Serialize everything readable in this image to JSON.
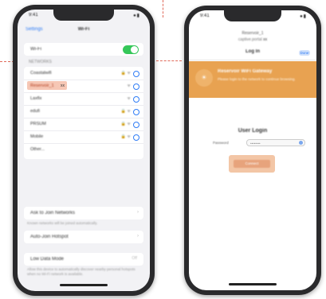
{
  "left_phone": {
    "status_time": "9:41",
    "status_icons": "●▮",
    "nav_back": "Settings",
    "nav_title": "Wi-Fi",
    "wifi_label": "Wi-Fi",
    "section_header": "NETWORKS",
    "networks": [
      {
        "name": "Coastalwifi",
        "meta": "🔒 ᯤ"
      },
      {
        "name": "Reservoir_1",
        "meta": "ᯤ"
      },
      {
        "name": "Laxfix",
        "meta": "ᯤ"
      },
      {
        "name": "edufi",
        "meta": "🔒 ᯤ"
      },
      {
        "name": "PRSUM",
        "meta": "🔒 ᯤ"
      },
      {
        "name": "Mobile",
        "meta": "🔒 ᯤ"
      },
      {
        "name": "Other...",
        "meta": ""
      }
    ],
    "highlight_mark": "xx",
    "ask_join_label": "Ask to Join Networks",
    "ask_join_footer": "Known networks will be joined automatically.",
    "hotspot_label": "Auto-Join Hotspot",
    "low_data_label": "Low Data Mode",
    "low_data_value": "Off",
    "footer_text": "Allow this device to automatically discover nearby personal hotspots when no Wi-Fi network is available."
  },
  "right_phone": {
    "status_time": "9:41",
    "status_icons": "●▮",
    "sheet_title": "Reservoir_1",
    "sheet_subtitle": "captive.portal",
    "sheet_mark": "xx",
    "bar_title": "Log In",
    "done_label": "Done",
    "banner_logo": "☀",
    "banner_heading": "Reservoir WiFi Gateway",
    "banner_desc": "Please login to the network to continue browsing.",
    "login_title": "User Login",
    "password_label": "Password",
    "password_placeholder": "••••••••",
    "connect_label": "Connect"
  },
  "colors": {
    "toggle_on": "#35c759",
    "banner": "#e8a251",
    "highlight": "#f6c7b5",
    "guide": "#e06a5a"
  }
}
